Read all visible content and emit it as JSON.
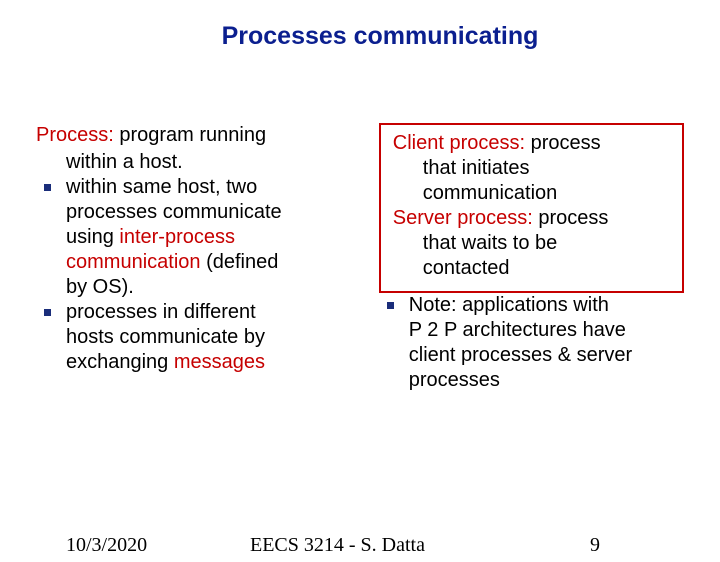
{
  "title": "Processes communicating",
  "left": {
    "process_term": "Process:",
    "process_def_1": " program running",
    "process_def_2": "within a host.",
    "b1_l1": "within same host, two",
    "b1_l2": "processes communicate",
    "b1_l3_pre": "using  ",
    "b1_l3_term": "inter-process",
    "b1_l4_term": "communication",
    "b1_l4_post": " (defined",
    "b1_l5": "by OS).",
    "b2_l1": "processes in different",
    "b2_l2": "hosts communicate by",
    "b2_l3_pre": "exchanging ",
    "b2_l3_term": "messages"
  },
  "right": {
    "client_term": "Client process:",
    "client_l1": " process",
    "client_l2": "that initiates",
    "client_l3": "communication",
    "server_term": "Server process:",
    "server_l1": " process",
    "server_l2": "that waits to be",
    "server_l3": "contacted",
    "note_l1": "Note: applications with",
    "note_l2": "P 2 P architectures have",
    "note_l3": "client processes & server",
    "note_l4": "processes"
  },
  "footer": {
    "date": "10/3/2020",
    "course": "EECS 3214 - S. Datta",
    "page": "9"
  }
}
